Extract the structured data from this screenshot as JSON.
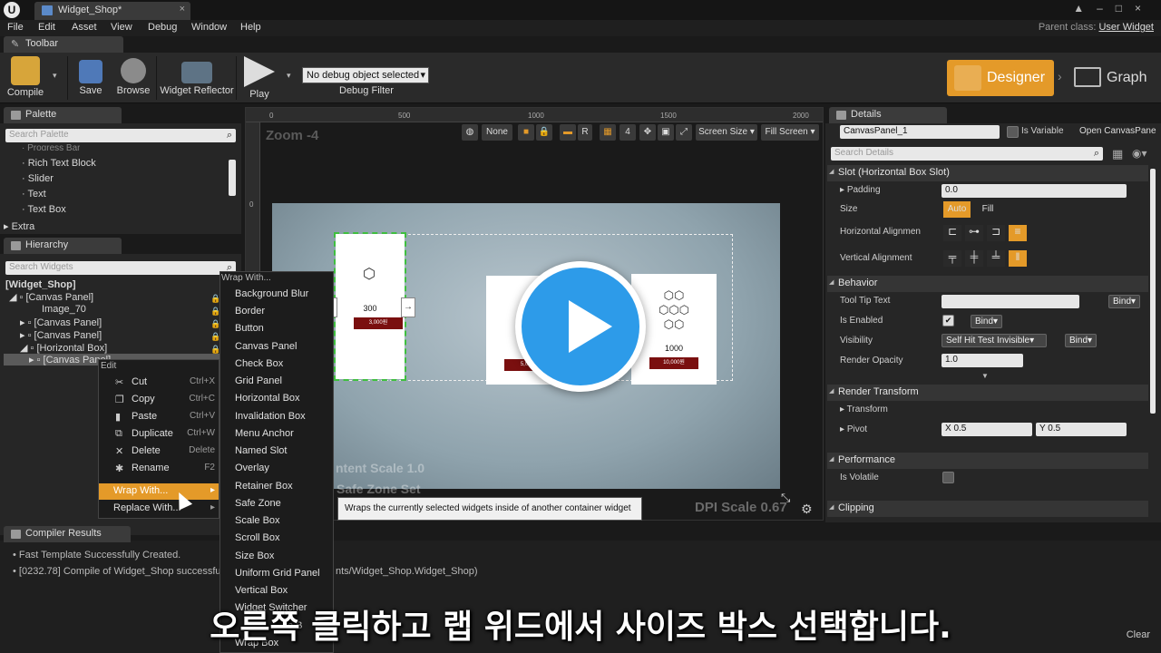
{
  "window": {
    "tab_title": "Widget_Shop*",
    "parent_class_label": "Parent class:",
    "parent_class_value": "User Widget"
  },
  "menu": [
    "File",
    "Edit",
    "Asset",
    "View",
    "Debug",
    "Window",
    "Help"
  ],
  "toolbar": {
    "tab": "Toolbar",
    "buttons": {
      "compile": "Compile",
      "save": "Save",
      "browse": "Browse",
      "widget_reflector": "Widget Reflector",
      "play": "Play"
    },
    "debug_select": "No debug object selected",
    "debug_filter": "Debug Filter",
    "designer": "Designer",
    "graph": "Graph"
  },
  "palette": {
    "tab": "Palette",
    "search_placeholder": "Search Palette",
    "items": [
      "Progress Bar",
      "Rich Text Block",
      "Slider",
      "Text",
      "Text Box"
    ],
    "category": "Extra"
  },
  "hierarchy": {
    "tab": "Hierarchy",
    "search_placeholder": "Search Widgets",
    "rows": [
      "[Widget_Shop]",
      "[Canvas Panel]",
      "Image_70",
      "[Canvas Panel]",
      "[Canvas Panel]",
      "[Horizontal Box]",
      "[Canvas Panel]"
    ]
  },
  "viewport": {
    "ruler_h": [
      "0",
      "500",
      "1000",
      "1500",
      "2000"
    ],
    "ruler_v": [
      "0"
    ],
    "zoom": "Zoom -4",
    "tools": {
      "none": "None",
      "r": "R",
      "grid": "4",
      "screen_size": "Screen Size",
      "fill_screen": "Fill Screen"
    },
    "card1_amount": "300",
    "card1_price": "3,000원",
    "card2_price": "5,0",
    "card3_amount": "1000",
    "card3_price": "10,000원",
    "content_scale": "ntent Scale 1.0",
    "safe_zone": "Safe Zone Set",
    "dpi": "DPI Scale 0.67"
  },
  "context_menu": {
    "header": "Edit",
    "items": [
      {
        "label": "Cut",
        "shortcut": "Ctrl+X"
      },
      {
        "label": "Copy",
        "shortcut": "Ctrl+C"
      },
      {
        "label": "Paste",
        "shortcut": "Ctrl+V"
      },
      {
        "label": "Duplicate",
        "shortcut": "Ctrl+W"
      },
      {
        "label": "Delete",
        "shortcut": "Delete"
      },
      {
        "label": "Rename",
        "shortcut": "F2"
      }
    ],
    "wrap_with": "Wrap With...",
    "replace_with": "Replace With..."
  },
  "wrap_menu": {
    "header": "Wrap With...",
    "items": [
      "Background Blur",
      "Border",
      "Button",
      "Canvas Panel",
      "Check Box",
      "Grid Panel",
      "Horizontal Box",
      "Invalidation Box",
      "Menu Anchor",
      "Named Slot",
      "Overlay",
      "Retainer Box",
      "Safe Zone",
      "Scale Box",
      "Scroll Box",
      "Size Box",
      "Uniform Grid Panel",
      "Vertical Box",
      "Widget Switcher",
      "Wrap Box"
    ],
    "partial_row": "e B"
  },
  "tooltip": "Wraps the currently selected widgets inside of another container widget",
  "details": {
    "tab": "Details",
    "name": "CanvasPanel_1",
    "is_variable": "Is Variable",
    "open_link": "Open CanvasPane",
    "search_placeholder": "Search Details",
    "slot_section": "Slot (Horizontal Box Slot)",
    "padding_label": "Padding",
    "padding_value": "0.0",
    "size_label": "Size",
    "size_auto": "Auto",
    "size_fill": "Fill",
    "h_align": "Horizontal Alignmen",
    "v_align": "Vertical Alignment",
    "behavior_section": "Behavior",
    "tooltip_label": "Tool Tip Text",
    "bind": "Bind",
    "enabled_label": "Is Enabled",
    "visibility_label": "Visibility",
    "visibility_value": "Self Hit Test Invisible",
    "opacity_label": "Render Opacity",
    "opacity_value": "1.0",
    "render_transform_section": "Render Transform",
    "transform_label": "Transform",
    "pivot_label": "Pivot",
    "pivot_x": "X  0.5",
    "pivot_y": "Y  0.5",
    "performance_section": "Performance",
    "volatile_label": "Is Volatile",
    "clipping_section": "Clipping"
  },
  "compiler": {
    "tab": "Compiler Results",
    "lines": [
      "Fast Template Successfully Created.",
      "[0232.78] Compile of Widget_Shop successfu"
    ],
    "line2_tail": "nts/Widget_Shop.Widget_Shop)",
    "clear": "Clear"
  },
  "caption": "오른쪽 클릭하고 랩 위드에서 사이즈 박스 선택합니다."
}
